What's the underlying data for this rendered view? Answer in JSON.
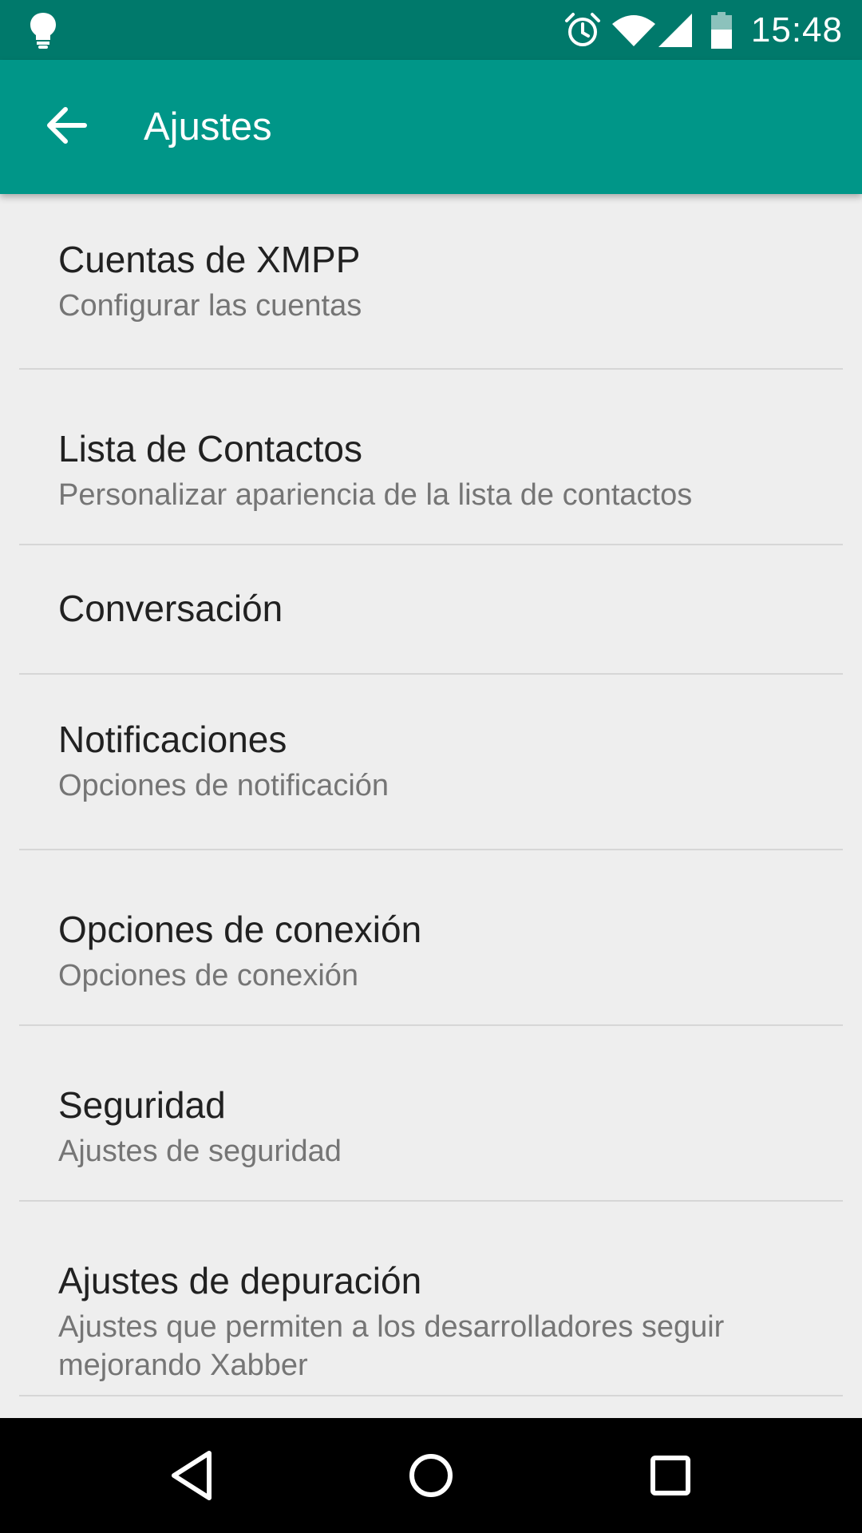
{
  "status_bar": {
    "time": "15:48",
    "icons": [
      "lightbulb-icon",
      "alarm-icon",
      "wifi-icon",
      "signal-icon",
      "battery-icon"
    ]
  },
  "app_bar": {
    "title": "Ajustes",
    "back_icon": "arrow-back-icon",
    "color": "#009688",
    "status_color": "#00796b"
  },
  "settings": [
    {
      "title": "Cuentas de XMPP",
      "summary": "Configurar las cuentas"
    },
    {
      "title": "Lista de Contactos",
      "summary": "Personalizar apariencia de la lista de contactos"
    },
    {
      "title": "Conversación",
      "summary": ""
    },
    {
      "title": "Notificaciones",
      "summary": "Opciones de notificación"
    },
    {
      "title": "Opciones de conexión",
      "summary": "Opciones de conexión"
    },
    {
      "title": "Seguridad",
      "summary": "Ajustes de seguridad"
    },
    {
      "title": "Ajustes de depuración",
      "summary": "Ajustes que permiten a los desarrolladores seguir mejorando Xabber"
    }
  ],
  "nav_bar": {
    "icons": [
      "nav-back-icon",
      "nav-home-icon",
      "nav-recents-icon"
    ]
  }
}
